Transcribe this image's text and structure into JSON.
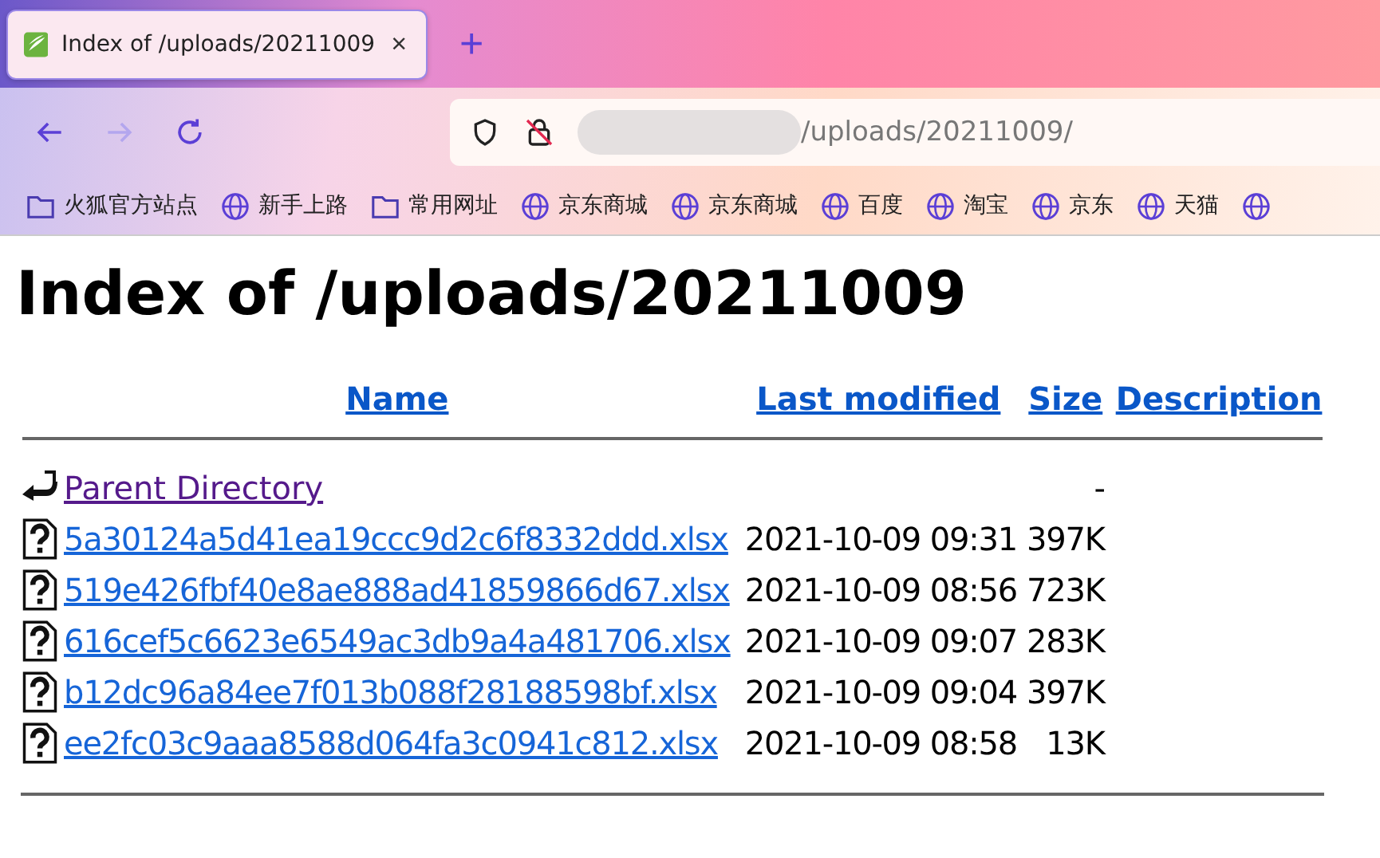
{
  "tab": {
    "title": "Index of /uploads/20211009",
    "close": "×",
    "selected": true
  },
  "new_tab": "+",
  "address_bar": {
    "url": "/uploads/20211009/"
  },
  "bookmarks": [
    {
      "kind": "folder",
      "label": "火狐官方站点"
    },
    {
      "kind": "globe",
      "label": "新手上路"
    },
    {
      "kind": "folder",
      "label": "常用网址"
    },
    {
      "kind": "globe",
      "label": "京东商城"
    },
    {
      "kind": "globe",
      "label": "京东商城"
    },
    {
      "kind": "globe",
      "label": "百度"
    },
    {
      "kind": "globe",
      "label": "淘宝"
    },
    {
      "kind": "globe",
      "label": "京东"
    },
    {
      "kind": "globe",
      "label": "天猫"
    },
    {
      "kind": "globe"
    }
  ],
  "heading": "Index of /uploads/20211009",
  "table": {
    "columns": [
      "Name",
      "Last modified",
      "Size",
      "Description"
    ],
    "rows": [
      {
        "kind": "parent",
        "name": "Parent Directory",
        "visited": true,
        "modified": "",
        "size": "-"
      },
      {
        "kind": "file",
        "name": "5a30124a5d41ea19ccc9d2c6f8332ddd.xlsx",
        "visited": false,
        "modified": "2021-10-09 09:31",
        "size": "397K"
      },
      {
        "kind": "file",
        "name": "519e426fbf40e8ae888ad41859866d67.xlsx",
        "visited": false,
        "modified": "2021-10-09 08:56",
        "size": "723K"
      },
      {
        "kind": "file",
        "name": "616cef5c6623e6549ac3db9a4a481706.xlsx",
        "visited": false,
        "modified": "2021-10-09 09:07",
        "size": "283K"
      },
      {
        "kind": "file",
        "name": "b12dc96a84ee7f013b088f28188598bf.xlsx",
        "visited": false,
        "modified": "2021-10-09 09:04",
        "size": "397K"
      },
      {
        "kind": "file",
        "name": "ee2fc03c9aaa8588d064fa3c0941c812.xlsx",
        "visited": false,
        "modified": "2021-10-09 08:58",
        "size": "13K"
      }
    ]
  }
}
